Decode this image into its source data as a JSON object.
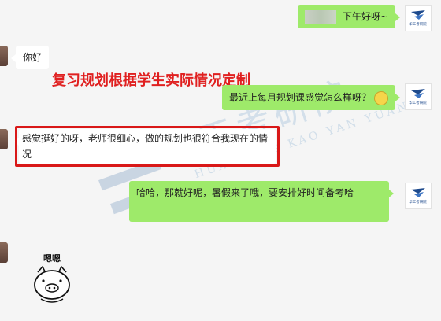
{
  "messages": [
    {
      "side": "right",
      "text": "下午好呀~"
    },
    {
      "side": "left",
      "text": "你好"
    },
    {
      "side": "right",
      "text": "最近上每月规划课感觉怎么样呀？"
    },
    {
      "side": "left",
      "text": "感觉挺好的呀，老师很细心，做的规划也很符合我现在的情况"
    },
    {
      "side": "right",
      "text": "哈哈，那就好呢，暑假来了哦，要安排好时间备考哈"
    },
    {
      "side": "left",
      "sticker_caption": "嗯嗯"
    }
  ],
  "annotation": "复习规划根据学生实际情况定制",
  "watermark": {
    "main": "华工考研院",
    "sub": "HUA GONG KAO YAN YUAN"
  },
  "logo_text": "华工考研院",
  "colors": {
    "green_bubble": "#9eea6a",
    "highlight": "#d91818",
    "annotation": "#e02020"
  }
}
